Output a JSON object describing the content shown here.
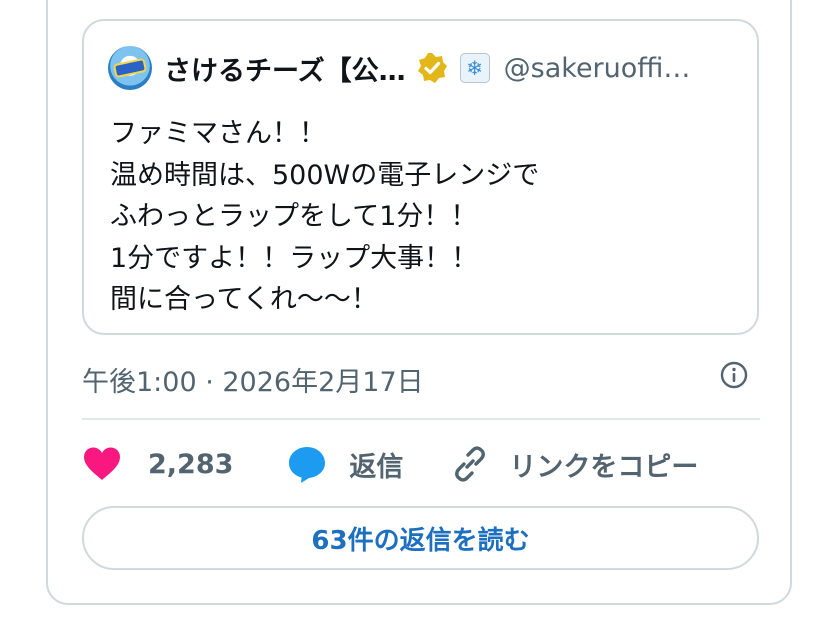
{
  "quoted_tweet": {
    "display_name": "さけるチーズ【公…",
    "handle": "@sakeruoffi…",
    "lines": [
      "ファミマさん！！",
      "温め時間は、500Wの電子レンジで",
      "ふわっとラップをして1分！！",
      "1分ですよ！！ラップ大事！！",
      "間に合ってくれ〜〜！"
    ]
  },
  "timestamp": "午後1:00 · 2026年2月17日",
  "actions": {
    "like_count": "2,283",
    "reply_label": "返信",
    "copy_link_label": "リンクをコピー"
  },
  "read_replies_label": "63件の返信を読む",
  "colors": {
    "like": "#f91880",
    "reply": "#1d9bf0",
    "verified": "#e2b719",
    "link_text": "#1d6fc0"
  },
  "icons": {
    "verified": "verified-badge-icon",
    "emoji": "snowflake-icon",
    "info": "info-icon",
    "like": "heart-icon",
    "reply": "speech-bubble-icon",
    "copy_link": "link-icon"
  }
}
